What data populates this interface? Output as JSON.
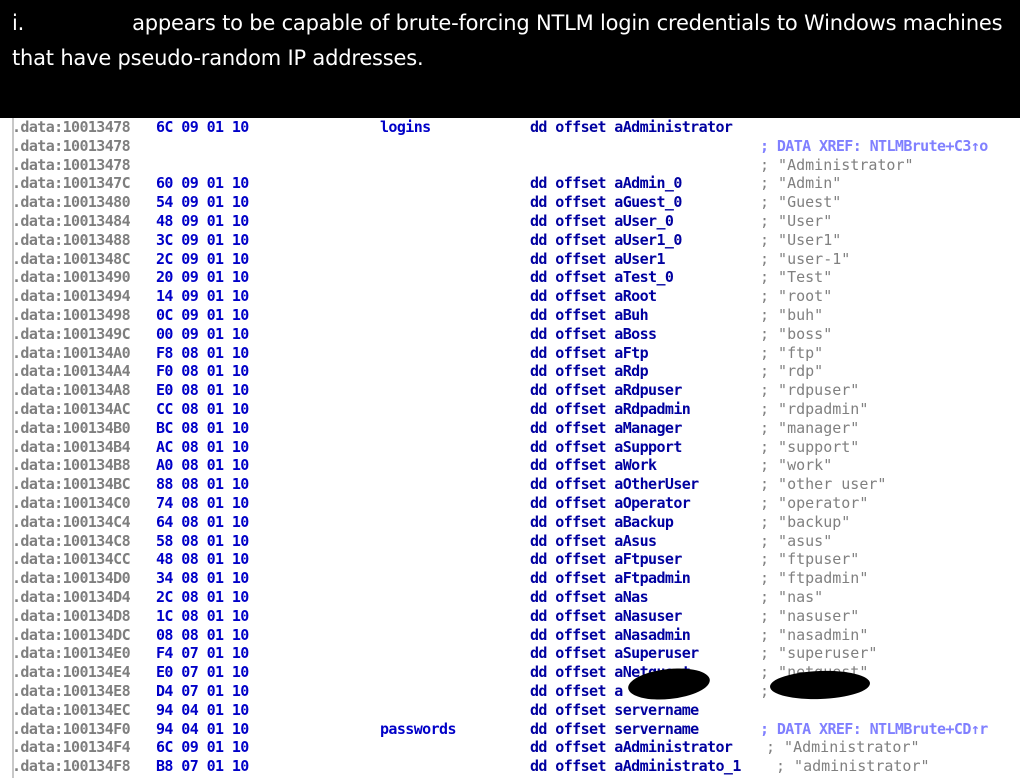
{
  "caption": {
    "prefix": "i.",
    "text_line1": "appears to be capable of brute-forcing NTLM login credentials to Windows machines",
    "text_line2": "that have pseudo-random IP addresses."
  },
  "listing": {
    "rows": [
      {
        "addr": ".data:10013478",
        "bytes": "6C 09 01 10",
        "label": "logins",
        "instr": "dd offset aAdministrator",
        "comment": ""
      },
      {
        "addr": ".data:10013478",
        "bytes": "",
        "label": "",
        "instr": "",
        "comment": "; DATA XREF: NTLMBrute+C3↑o",
        "xref": true
      },
      {
        "addr": ".data:10013478",
        "bytes": "",
        "label": "",
        "instr": "",
        "comment": "; \"Administrator\""
      },
      {
        "addr": ".data:1001347C",
        "bytes": "60 09 01 10",
        "label": "",
        "instr": "dd offset aAdmin_0",
        "comment": "; \"Admin\""
      },
      {
        "addr": ".data:10013480",
        "bytes": "54 09 01 10",
        "label": "",
        "instr": "dd offset aGuest_0",
        "comment": "; \"Guest\""
      },
      {
        "addr": ".data:10013484",
        "bytes": "48 09 01 10",
        "label": "",
        "instr": "dd offset aUser_0",
        "comment": "; \"User\""
      },
      {
        "addr": ".data:10013488",
        "bytes": "3C 09 01 10",
        "label": "",
        "instr": "dd offset aUser1_0",
        "comment": "; \"User1\""
      },
      {
        "addr": ".data:1001348C",
        "bytes": "2C 09 01 10",
        "label": "",
        "instr": "dd offset aUser1",
        "comment": "; \"user-1\""
      },
      {
        "addr": ".data:10013490",
        "bytes": "20 09 01 10",
        "label": "",
        "instr": "dd offset aTest_0",
        "comment": "; \"Test\""
      },
      {
        "addr": ".data:10013494",
        "bytes": "14 09 01 10",
        "label": "",
        "instr": "dd offset aRoot",
        "comment": "; \"root\""
      },
      {
        "addr": ".data:10013498",
        "bytes": "0C 09 01 10",
        "label": "",
        "instr": "dd offset aBuh",
        "comment": "; \"buh\""
      },
      {
        "addr": ".data:1001349C",
        "bytes": "00 09 01 10",
        "label": "",
        "instr": "dd offset aBoss",
        "comment": "; \"boss\""
      },
      {
        "addr": ".data:100134A0",
        "bytes": "F8 08 01 10",
        "label": "",
        "instr": "dd offset aFtp",
        "comment": "; \"ftp\""
      },
      {
        "addr": ".data:100134A4",
        "bytes": "F0 08 01 10",
        "label": "",
        "instr": "dd offset aRdp",
        "comment": "; \"rdp\""
      },
      {
        "addr": ".data:100134A8",
        "bytes": "E0 08 01 10",
        "label": "",
        "instr": "dd offset aRdpuser",
        "comment": "; \"rdpuser\""
      },
      {
        "addr": ".data:100134AC",
        "bytes": "CC 08 01 10",
        "label": "",
        "instr": "dd offset aRdpadmin",
        "comment": "; \"rdpadmin\""
      },
      {
        "addr": ".data:100134B0",
        "bytes": "BC 08 01 10",
        "label": "",
        "instr": "dd offset aManager",
        "comment": "; \"manager\""
      },
      {
        "addr": ".data:100134B4",
        "bytes": "AC 08 01 10",
        "label": "",
        "instr": "dd offset aSupport",
        "comment": "; \"support\""
      },
      {
        "addr": ".data:100134B8",
        "bytes": "A0 08 01 10",
        "label": "",
        "instr": "dd offset aWork",
        "comment": "; \"work\""
      },
      {
        "addr": ".data:100134BC",
        "bytes": "88 08 01 10",
        "label": "",
        "instr": "dd offset aOtherUser",
        "comment": "; \"other user\""
      },
      {
        "addr": ".data:100134C0",
        "bytes": "74 08 01 10",
        "label": "",
        "instr": "dd offset aOperator",
        "comment": "; \"operator\""
      },
      {
        "addr": ".data:100134C4",
        "bytes": "64 08 01 10",
        "label": "",
        "instr": "dd offset aBackup",
        "comment": "; \"backup\""
      },
      {
        "addr": ".data:100134C8",
        "bytes": "58 08 01 10",
        "label": "",
        "instr": "dd offset aAsus",
        "comment": "; \"asus\""
      },
      {
        "addr": ".data:100134CC",
        "bytes": "48 08 01 10",
        "label": "",
        "instr": "dd offset aFtpuser",
        "comment": "; \"ftpuser\""
      },
      {
        "addr": ".data:100134D0",
        "bytes": "34 08 01 10",
        "label": "",
        "instr": "dd offset aFtpadmin",
        "comment": "; \"ftpadmin\""
      },
      {
        "addr": ".data:100134D4",
        "bytes": "2C 08 01 10",
        "label": "",
        "instr": "dd offset aNas",
        "comment": "; \"nas\""
      },
      {
        "addr": ".data:100134D8",
        "bytes": "1C 08 01 10",
        "label": "",
        "instr": "dd offset aNasuser",
        "comment": "; \"nasuser\""
      },
      {
        "addr": ".data:100134DC",
        "bytes": "08 08 01 10",
        "label": "",
        "instr": "dd offset aNasadmin",
        "comment": "; \"nasadmin\""
      },
      {
        "addr": ".data:100134E0",
        "bytes": "F4 07 01 10",
        "label": "",
        "instr": "dd offset aSuperuser",
        "comment": "; \"superuser\""
      },
      {
        "addr": ".data:100134E4",
        "bytes": "E0 07 01 10",
        "label": "",
        "instr": "dd offset aNetguest",
        "comment": "; \"netguest\""
      },
      {
        "addr": ".data:100134E8",
        "bytes": "D4 07 01 10",
        "label": "",
        "instr": "dd offset a",
        "comment": ";"
      },
      {
        "addr": ".data:100134EC",
        "bytes": "94 04 01 10",
        "label": "",
        "instr": "dd offset servername",
        "comment": ""
      },
      {
        "addr": ".data:100134F0",
        "bytes": "94 04 01 10",
        "label": "passwords",
        "instr": "dd offset servername",
        "comment": "; DATA XREF: NTLMBrute+CD↑r",
        "xref": true
      },
      {
        "addr": ".data:100134F4",
        "bytes": "6C 09 01 10",
        "label": "",
        "instr": "dd offset aAdministrator",
        "comment": "; \"Administrator\""
      },
      {
        "addr": ".data:100134F8",
        "bytes": "B8 07 01 10",
        "label": "",
        "instr": "dd offset aAdministrato_1",
        "comment": "; \"administrator\""
      }
    ]
  }
}
